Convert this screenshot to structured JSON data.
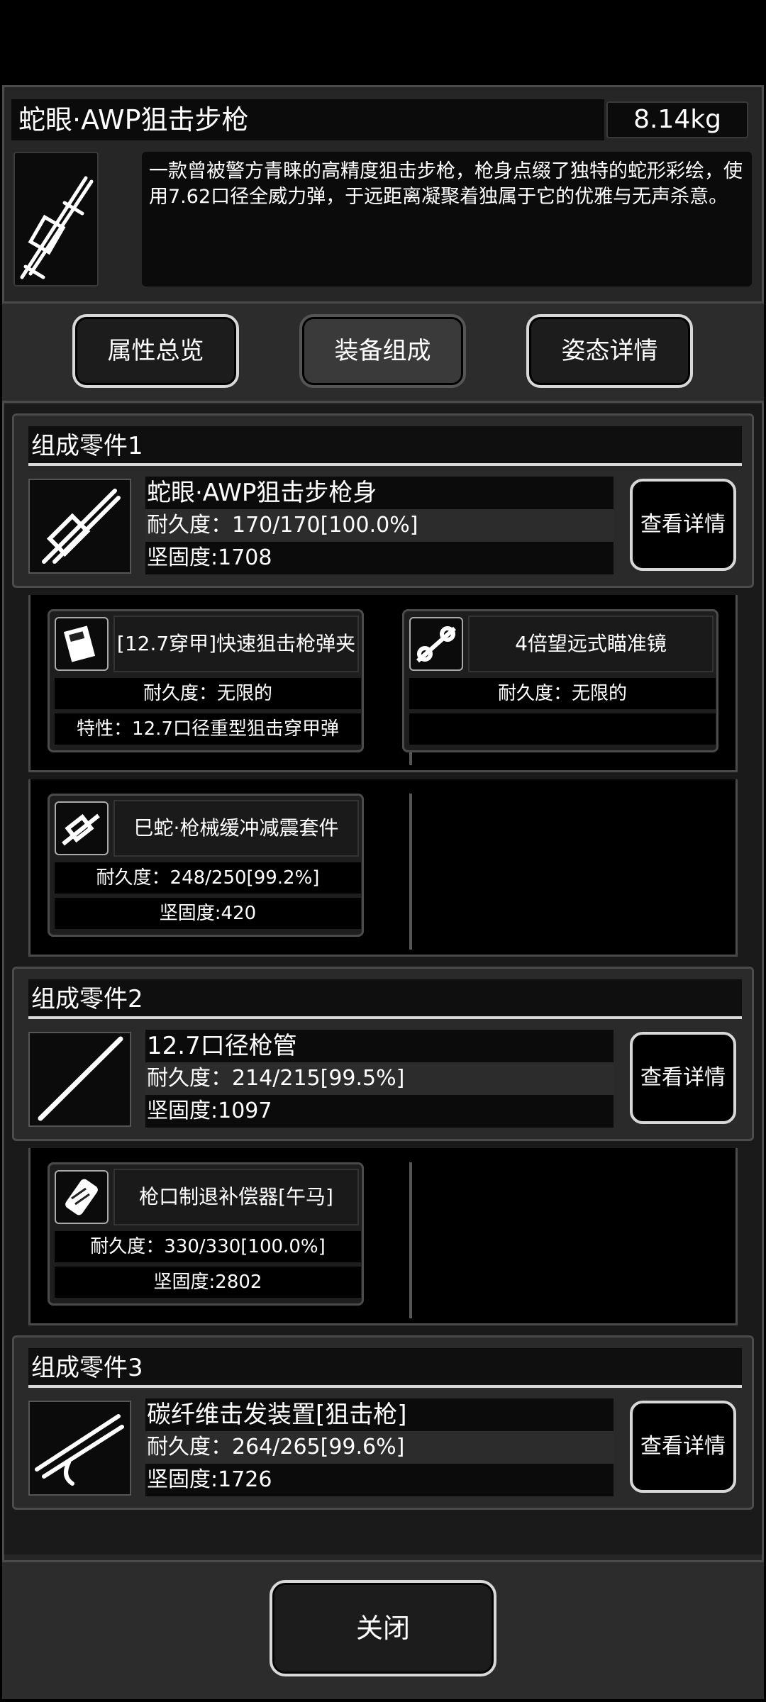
{
  "item": {
    "name": "蛇眼·AWP狙击步枪",
    "weight": "8.14kg",
    "description": "一款曾被警方青睐的高精度狙击步枪，枪身点缀了独特的蛇形彩绘，使用7.62口径全威力弹，于远距离凝聚着独属于它的优雅与无声杀意。",
    "icon": "sniper-rifle-icon"
  },
  "tabs": [
    {
      "label": "属性总览"
    },
    {
      "label": "装备组成"
    },
    {
      "label": "姿态详情"
    }
  ],
  "groups": [
    {
      "title": "组成零件1",
      "part": {
        "name": "蛇眼·AWP狙击步枪身",
        "durability": "耐久度：170/170[100.0%]",
        "hardness": "坚固度:1708",
        "icon": "rifle-body-icon"
      },
      "detail_label": "查看详情",
      "attachments": [
        {
          "name": "[12.7穿甲]快速狙击枪弹夹",
          "row1": "耐久度：无限的",
          "row2": "特性：12.7口径重型狙击穿甲弹",
          "icon": "magazine-icon"
        },
        {
          "name": "4倍望远式瞄准镜",
          "row1": "耐久度：无限的",
          "row2": "",
          "icon": "scope-icon"
        },
        {
          "name": "巳蛇·枪械缓冲减震套件",
          "row1": "耐久度：248/250[99.2%]",
          "row2": "坚固度:420",
          "icon": "stock-kit-icon"
        }
      ]
    },
    {
      "title": "组成零件2",
      "part": {
        "name": "12.7口径枪管",
        "durability": "耐久度：214/215[99.5%]",
        "hardness": "坚固度:1097",
        "icon": "barrel-icon"
      },
      "detail_label": "查看详情",
      "attachments": [
        {
          "name": "枪口制退补偿器[午马]",
          "row1": "耐久度：330/330[100.0%]",
          "row2": "坚固度:2802",
          "icon": "muzzle-brake-icon"
        }
      ]
    },
    {
      "title": "组成零件3",
      "part": {
        "name": "碳纤维击发装置[狙击枪]",
        "durability": "耐久度：264/265[99.6%]",
        "hardness": "坚固度:1726",
        "icon": "trigger-assembly-icon"
      },
      "detail_label": "查看详情",
      "attachments": []
    }
  ],
  "close_label": "关闭"
}
